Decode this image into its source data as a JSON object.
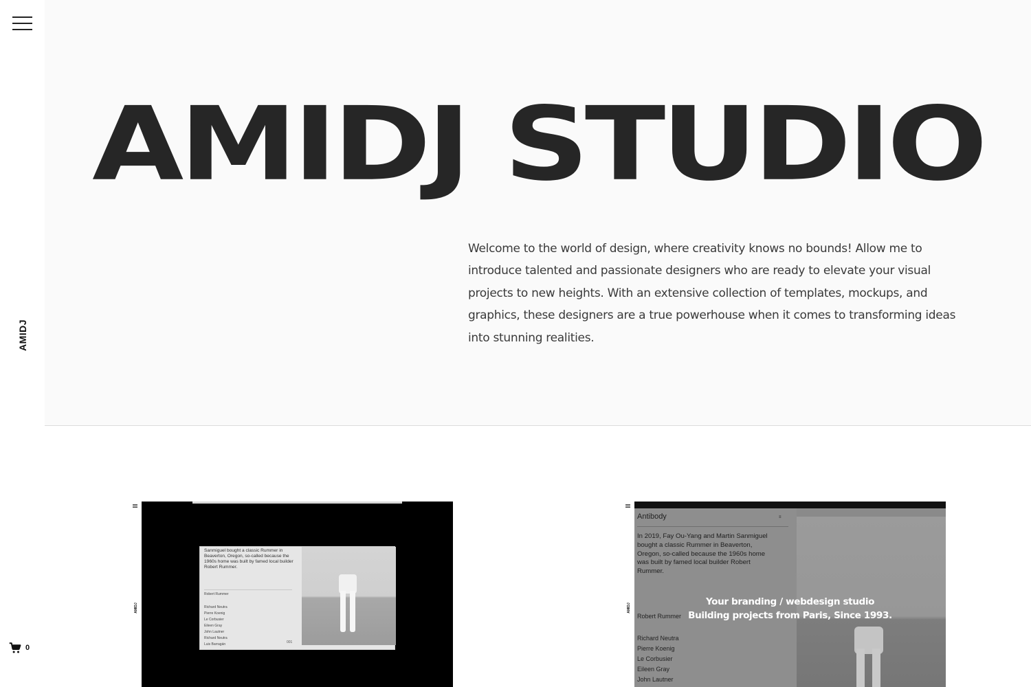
{
  "sidebar": {
    "menu_icon": "hamburger-menu-icon",
    "logo": "AMIDJ",
    "cart_icon": "shopping-cart-icon",
    "cart_count": "0"
  },
  "hero": {
    "title": "AMIDJ STUDIO",
    "intro": "Welcome to the world of design, where creativity knows no bounds! Allow me to introduce talented and passionate designers who are ready to elevate your visual projects to new heights. With an extensive collection of templates, mockups, and graphics, these designers are a true powerhouse when it comes to transforming ideas into stunning realities."
  },
  "cards": [
    {
      "preview_logo": "AMIDJ",
      "paragraph": "Sanmiguel bought a classic Rummer in Beaverton, Oregon, so-called because the 1960s home was built by famed local builder Robert Rummer.",
      "heading": "Robert Rummer",
      "names": [
        "Richard Neutra",
        "Pierre Koenig",
        "Le Corbusier",
        "Eileen Gray",
        "John Lautner",
        "Richard Neutra",
        "Luis Barragán"
      ],
      "number": "001"
    },
    {
      "preview_logo": "AMIDJ",
      "brand": "Antibody",
      "paragraph": "In 2019, Fay Ou-Yang and Martin Sanmiguel bought a classic Rummer in Beaverton, Oregon, so-called because the 1960s home was built by famed local builder Robert Rummer.",
      "heading": "Robert Rummer",
      "names": [
        "Richard Neutra",
        "Pierre Koenig",
        "Le Corbusier",
        "Eileen Gray",
        "John Lautner"
      ],
      "overlay_line1": "Your branding / webdesign studio",
      "overlay_line2": "Building projects from Paris, Since 1993."
    }
  ]
}
